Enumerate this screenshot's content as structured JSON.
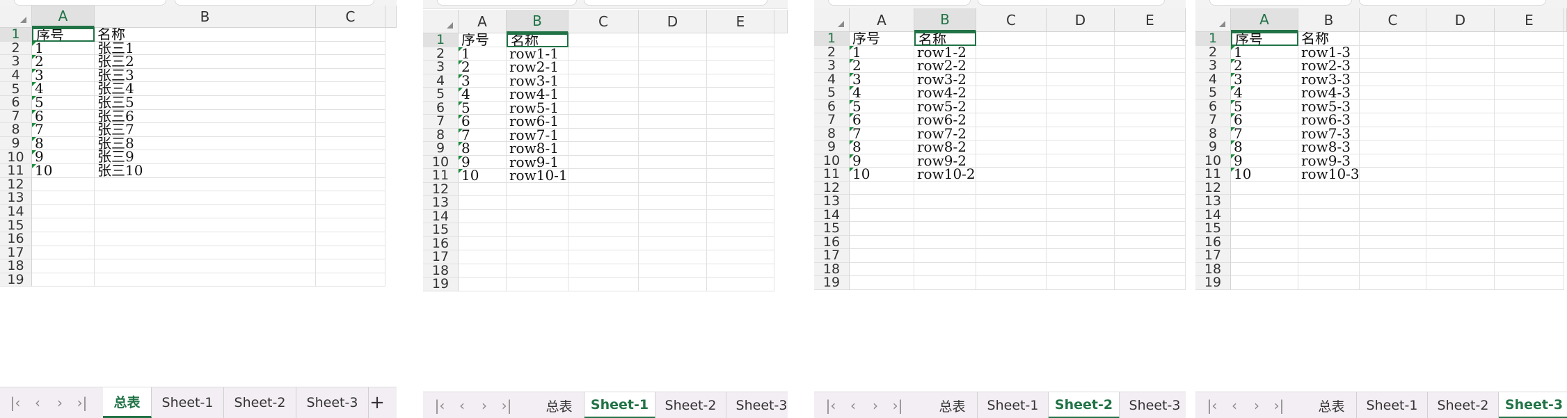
{
  "panels": [
    {
      "columns": [
        "A",
        "B",
        "C"
      ],
      "selected_col": "A",
      "active_cell": {
        "row": 1,
        "col": "A"
      },
      "rows": [
        [
          "序号",
          "名称"
        ],
        [
          "1",
          "张三1"
        ],
        [
          "2",
          "张三2"
        ],
        [
          "3",
          "张三3"
        ],
        [
          "4",
          "张三4"
        ],
        [
          "5",
          "张三5"
        ],
        [
          "6",
          "张三6"
        ],
        [
          "7",
          "张三7"
        ],
        [
          "8",
          "张三8"
        ],
        [
          "9",
          "张三9"
        ],
        [
          "10",
          "张三10"
        ]
      ],
      "row_numbers": [
        "1",
        "2",
        "3",
        "4",
        "5",
        "6",
        "7",
        "8",
        "9",
        "10",
        "11",
        "12",
        "13",
        "14",
        "15",
        "16",
        "17",
        "18",
        "19"
      ],
      "tabs": [
        "总表",
        "Sheet-1",
        "Sheet-2",
        "Sheet-3"
      ],
      "active_tab": "总表",
      "show_add": true
    },
    {
      "columns": [
        "A",
        "B",
        "C",
        "D",
        "E"
      ],
      "selected_col": "B",
      "active_cell": {
        "row": 1,
        "col": "B"
      },
      "rows": [
        [
          "序号",
          "名称"
        ],
        [
          "1",
          "row1-1"
        ],
        [
          "2",
          "row2-1"
        ],
        [
          "3",
          "row3-1"
        ],
        [
          "4",
          "row4-1"
        ],
        [
          "5",
          "row5-1"
        ],
        [
          "6",
          "row6-1"
        ],
        [
          "7",
          "row7-1"
        ],
        [
          "8",
          "row8-1"
        ],
        [
          "9",
          "row9-1"
        ],
        [
          "10",
          "row10-1"
        ]
      ],
      "row_numbers": [
        "1",
        "2",
        "3",
        "4",
        "5",
        "6",
        "7",
        "8",
        "9",
        "10",
        "11",
        "12",
        "13",
        "14",
        "15",
        "16",
        "17",
        "18",
        "19"
      ],
      "tabs": [
        "总表",
        "Sheet-1",
        "Sheet-2",
        "Sheet-3"
      ],
      "active_tab": "Sheet-1",
      "show_add": false
    },
    {
      "columns": [
        "A",
        "B",
        "C",
        "D",
        "E"
      ],
      "selected_col": "B",
      "active_cell": {
        "row": 1,
        "col": "B"
      },
      "rows": [
        [
          "序号",
          "名称"
        ],
        [
          "1",
          "row1-2"
        ],
        [
          "2",
          "row2-2"
        ],
        [
          "3",
          "row3-2"
        ],
        [
          "4",
          "row4-2"
        ],
        [
          "5",
          "row5-2"
        ],
        [
          "6",
          "row6-2"
        ],
        [
          "7",
          "row7-2"
        ],
        [
          "8",
          "row8-2"
        ],
        [
          "9",
          "row9-2"
        ],
        [
          "10",
          "row10-2"
        ]
      ],
      "row_numbers": [
        "1",
        "2",
        "3",
        "4",
        "5",
        "6",
        "7",
        "8",
        "9",
        "10",
        "11",
        "12",
        "13",
        "14",
        "15",
        "16",
        "17",
        "18",
        "19"
      ],
      "tabs": [
        "总表",
        "Sheet-1",
        "Sheet-2",
        "Sheet-3"
      ],
      "active_tab": "Sheet-2",
      "show_add": false
    },
    {
      "columns": [
        "A",
        "B",
        "C",
        "D",
        "E"
      ],
      "selected_col": "A",
      "active_cell": {
        "row": 1,
        "col": "A"
      },
      "rows": [
        [
          "序号",
          "名称"
        ],
        [
          "1",
          "row1-3"
        ],
        [
          "2",
          "row2-3"
        ],
        [
          "3",
          "row3-3"
        ],
        [
          "4",
          "row4-3"
        ],
        [
          "5",
          "row5-3"
        ],
        [
          "6",
          "row6-3"
        ],
        [
          "7",
          "row7-3"
        ],
        [
          "8",
          "row8-3"
        ],
        [
          "9",
          "row9-3"
        ],
        [
          "10",
          "row10-3"
        ]
      ],
      "row_numbers": [
        "1",
        "2",
        "3",
        "4",
        "5",
        "6",
        "7",
        "8",
        "9",
        "10",
        "11",
        "12",
        "13",
        "14",
        "15",
        "16",
        "17",
        "18",
        "19"
      ],
      "tabs": [
        "总表",
        "Sheet-1",
        "Sheet-2",
        "Sheet-3"
      ],
      "active_tab": "Sheet-3",
      "show_add": false
    }
  ],
  "nav_icons": [
    "first-sheet-icon",
    "prev-sheet-icon",
    "next-sheet-icon",
    "last-sheet-icon"
  ],
  "nav_glyphs": [
    "|‹",
    "‹",
    "›",
    "›|"
  ],
  "add_sheet_glyph": "+",
  "accent_color": "#217346"
}
